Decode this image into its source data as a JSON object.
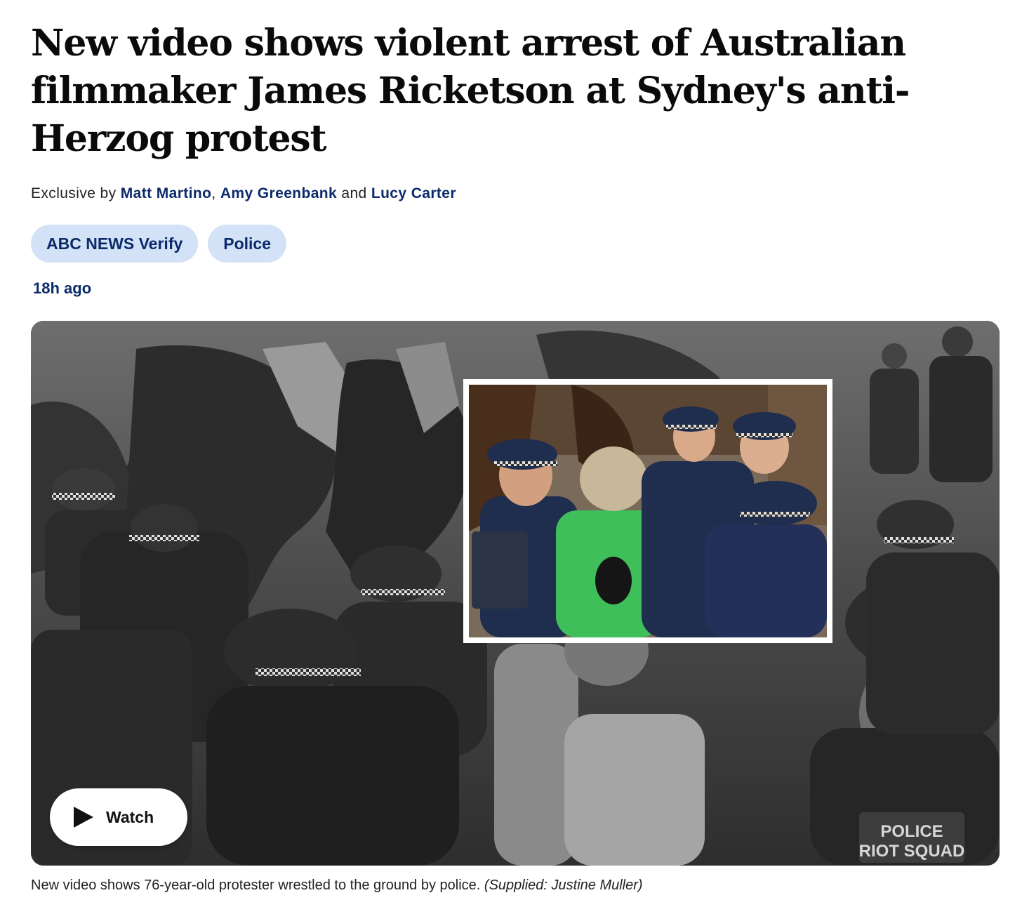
{
  "article": {
    "headline": "New video shows violent arrest of Australian filmmaker James Ricketson at Sydney's anti-Herzog protest",
    "byline": {
      "prefix": "Exclusive by ",
      "authors": [
        "Matt Martino",
        "Amy Greenbank",
        "Lucy Carter"
      ],
      "separator": ", ",
      "conjunction": " and "
    },
    "tags": [
      "ABC NEWS Verify",
      "Police"
    ],
    "timestamp": "18h ago"
  },
  "media": {
    "watch_label": "Watch",
    "vest_text_line1": "POLICE",
    "vest_text_line2": "RIOT SQUAD",
    "caption": "New video shows 76-year-old protester wrestled to the ground by police.",
    "credit": "(Supplied: Justine Muller)"
  },
  "colors": {
    "link_navy": "#0b2a6b",
    "tag_bg": "#d3e2f6",
    "protester_shirt": "#3fbf5a",
    "police_uniform": "#1f2d4f"
  },
  "icons": {
    "play": "play-icon"
  }
}
